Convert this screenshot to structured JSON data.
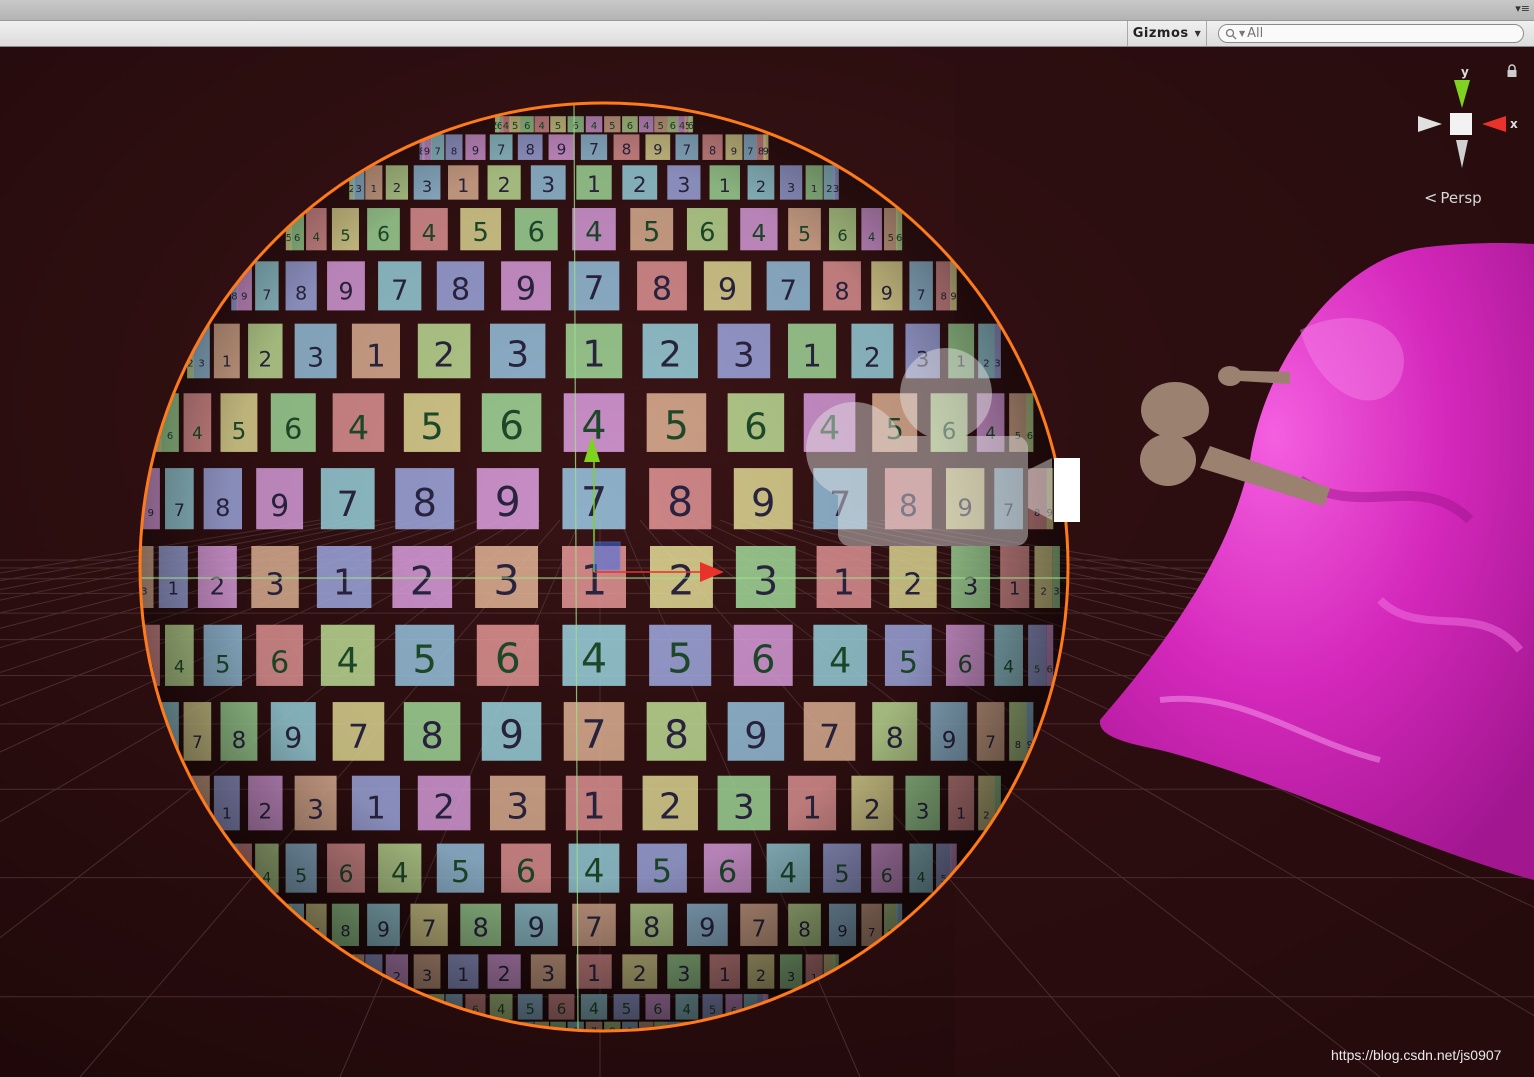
{
  "window": {
    "tab_menu_icon": "tab-menu-icon"
  },
  "toolbar": {
    "gizmos_label": "Gizmos",
    "search": {
      "placeholder": "All",
      "icon": "search-icon"
    }
  },
  "gizmo": {
    "y_label": "y",
    "x_label": "x",
    "projection_label": "Persp",
    "lock_icon": "lock-icon"
  },
  "viewport": {
    "background": "#2a0c0e",
    "sphere": {
      "texture_rows": [
        [
          "1",
          "2",
          "3",
          "1",
          "2",
          "3",
          "1",
          "2",
          "3",
          "1",
          "2",
          "3",
          "1",
          "2",
          "3",
          "1"
        ],
        [
          "4",
          "5",
          "6",
          "4",
          "5",
          "6",
          "4",
          "5",
          "6",
          "4",
          "5",
          "6",
          "4",
          "5",
          "6",
          "4"
        ],
        [
          "7",
          "8",
          "9",
          "7",
          "8",
          "9",
          "7",
          "8",
          "9",
          "7",
          "8",
          "9",
          "7",
          "8",
          "9",
          "7"
        ]
      ],
      "selection_outline": "#ff7a18"
    },
    "blob_color": "#e83ccf",
    "move_handle_colors": {
      "x": "#e8322a",
      "y": "#7ed321",
      "z": "#3a6fe8"
    }
  },
  "watermark": "https://blog.csdn.net/js0907"
}
